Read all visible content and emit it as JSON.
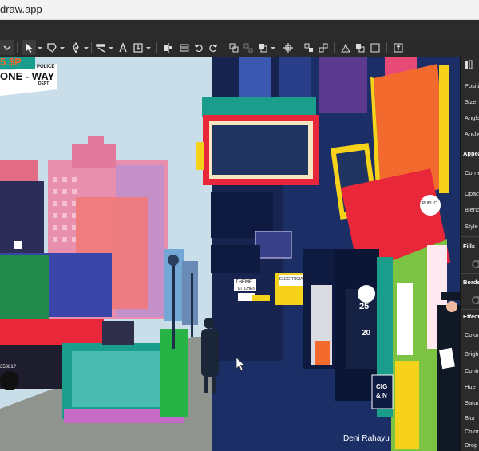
{
  "window": {
    "title": "draw.app"
  },
  "toolbar": {
    "icons": [
      "dropdown-chevron-icon",
      "select-arrow-icon",
      "shape-tool-icon",
      "pen-tool-icon",
      "brush-tool-icon",
      "text-tool-icon",
      "import-icon",
      "align-icon",
      "distribute-icon",
      "undo-icon",
      "redo-icon",
      "group-icon",
      "ungroup-icon",
      "arrange-icon",
      "boolean-icon",
      "transform-icon",
      "node-icon",
      "flip-icon",
      "export-icon"
    ]
  },
  "artwork": {
    "sign_top": "5 $P",
    "sign_police": "POLICE",
    "sign_main": "ONE - WAY",
    "sign_dept": "DEPT",
    "sign_theme": "THEME",
    "sign_kitchen": "KITCHEN",
    "sign_electrician": "ELECTRICIAN",
    "sign_public": "PUBLIC",
    "sign_number": "25",
    "sign_number2": "20",
    "sign_cigar": "CIG",
    "sign_and": "& N",
    "plate": "350817",
    "credit": "Deni Rahayu"
  },
  "panel": {
    "items": [
      "Positio",
      "Size",
      "Angle",
      "Ancho",
      "Appea",
      "Corne",
      "Opaci",
      "Blend",
      "Style",
      "Fills",
      "Borde",
      "Effects",
      "Color",
      "Brigh",
      "Contr",
      "Hue",
      "Satur",
      "Blur",
      "Color",
      "Drop"
    ]
  },
  "colors": {
    "sky": "#c9dee9",
    "street": "#8f948f",
    "accent_red": "#e8283a",
    "accent_yellow": "#f6d21a",
    "accent_orange": "#f26a2e",
    "toolbar_bg": "#2a2a2a",
    "panel_bg": "#2b2b2b"
  }
}
